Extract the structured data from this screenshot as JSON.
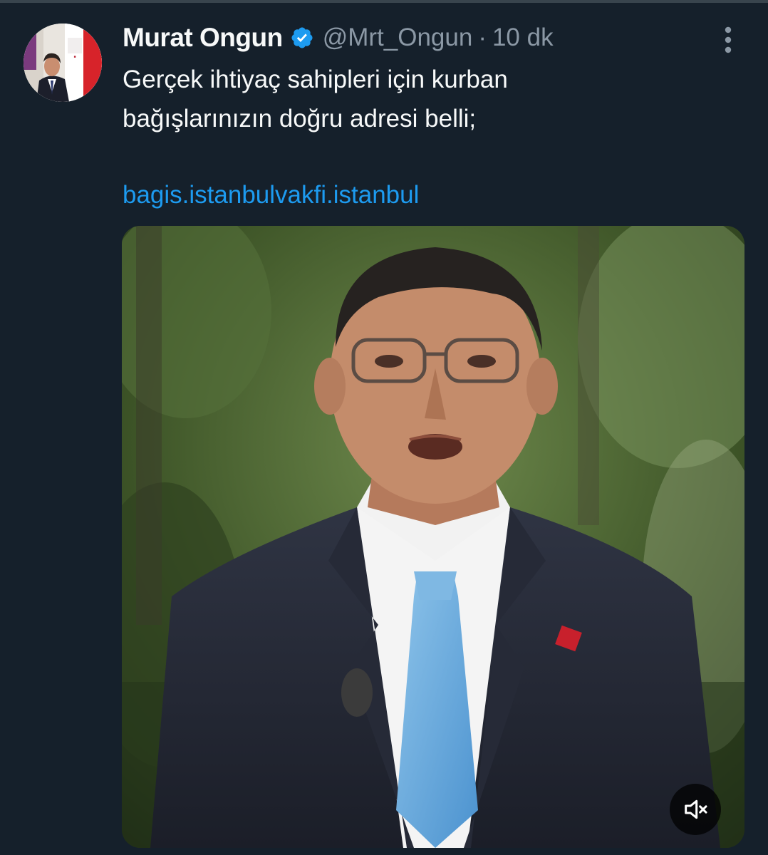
{
  "tweet": {
    "author": {
      "display_name": "Murat Ongun",
      "handle": "@Mrt_Ongun",
      "verified": true,
      "avatar_icon": "profile-photo"
    },
    "separator": "·",
    "timestamp": "10 dk",
    "text_lines": [
      "Gerçek ihtiyaç sahipleri için kurban",
      "bağışlarınızın doğru adresi belli;"
    ],
    "link": "bagis.istanbulvakfi.istanbul",
    "more_icon": "more-vertical-icon",
    "media": {
      "type": "video",
      "muted": true,
      "mute_icon": "volume-muted-icon"
    }
  },
  "colors": {
    "background": "#15202b",
    "text_primary": "#f7f9f9",
    "text_secondary": "#8b98a5",
    "link": "#1d9bf0",
    "verified": "#1d9bf0"
  }
}
